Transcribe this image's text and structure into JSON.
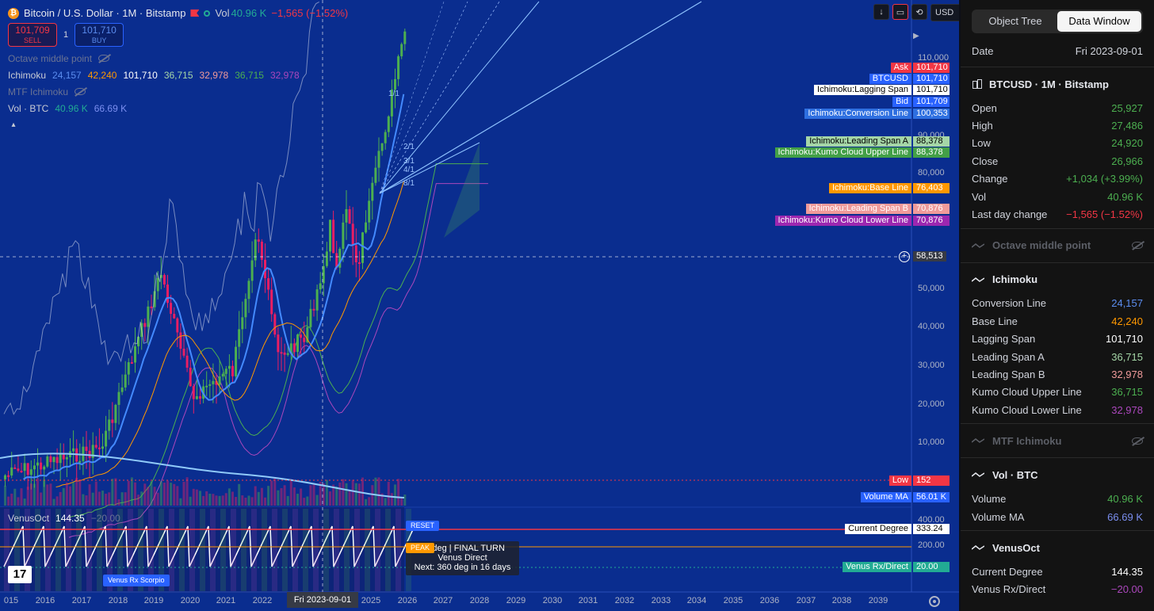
{
  "header": {
    "symbol_icon": "bitcoin-icon",
    "title": "Bitcoin / U.S. Dollar · 1M · Bitstamp",
    "vol_label": "Vol",
    "vol_value": "40.96 K",
    "change": "−1,565 (−1.52%)"
  },
  "trade": {
    "sell_price": "101,709",
    "sell_label": "SELL",
    "spread": "1",
    "buy_price": "101,710",
    "buy_label": "BUY"
  },
  "legend_indicators": {
    "octave": "Octave middle point",
    "ichimoku": "Ichimoku",
    "ichimoku_values": [
      "24,157",
      "42,240",
      "101,710",
      "36,715",
      "32,978",
      "36,715",
      "32,978"
    ],
    "mtf": "MTF Ichimoku",
    "vol": "Vol · BTC",
    "vol_values": [
      "40.96 K",
      "66.69 K"
    ]
  },
  "controls": {
    "currency": "USD"
  },
  "price_scale": {
    "ticks": [
      "110,000",
      "90,000",
      "80,000",
      "50,000",
      "40,000",
      "30,000",
      "20,000",
      "10,000",
      "400.00",
      "200.00"
    ],
    "crosshair_price": "58,513"
  },
  "price_labels": [
    {
      "name": "Ask",
      "value": "101,710",
      "color": "#f23645"
    },
    {
      "name": "BTCUSD",
      "value": "101,710",
      "color": "#2962ff"
    },
    {
      "name": "Ichimoku:Lagging Span",
      "value": "101,710",
      "color": "#ffffff"
    },
    {
      "name": "Bid",
      "value": "101,709",
      "color": "#2962ff"
    },
    {
      "name": "Ichimoku:Conversion Line",
      "value": "100,353",
      "color": "#2e6fe0"
    },
    {
      "name": "Ichimoku:Leading Span A",
      "value": "88,378",
      "color": "#a5d6a7"
    },
    {
      "name": "Ichimoku:Kumo Cloud Upper Line",
      "value": "88,378",
      "color": "#43a047"
    },
    {
      "name": "Ichimoku:Base Line",
      "value": "76,403",
      "color": "#ff9800"
    },
    {
      "name": "Ichimoku:Leading Span B",
      "value": "70,876",
      "color": "#ef9a9a"
    },
    {
      "name": "Ichimoku:Kumo Cloud Lower Line",
      "value": "70,876",
      "color": "#9c27b0"
    },
    {
      "name": "Low",
      "value": "152",
      "color": "#f23645"
    },
    {
      "name": "Volume MA",
      "value": "56.01 K",
      "color": "#2962ff"
    },
    {
      "name": "Current Degree",
      "value": "333.24",
      "color": "#ffffff"
    },
    {
      "name": "Venus Rx/Direct",
      "value": "20.00",
      "color": "#22ab94"
    }
  ],
  "fan_labels": [
    "2/1",
    "3/1",
    "4/1",
    "8/1",
    "1/1"
  ],
  "time_axis": {
    "ticks": [
      "015",
      "2016",
      "2017",
      "2018",
      "2019",
      "2020",
      "2021",
      "2022",
      "2025",
      "2026",
      "2027",
      "2028",
      "2029",
      "2030",
      "2031",
      "2032",
      "2033",
      "2034",
      "2035",
      "2036",
      "2037",
      "2038",
      "2039"
    ],
    "cursor": "Fri 2023-09-01"
  },
  "venus": {
    "name": "VenusOct",
    "value": "144.35",
    "value2": "−20.00",
    "tag": "Venus Rx Scorpio",
    "reset": "RESET",
    "peak": "PEAK",
    "tooltip_line1": "24 deg | FINAL TURN",
    "tooltip_line2": "Venus Direct",
    "tooltip_line3": "Next: 360 deg in 16 days"
  },
  "panel": {
    "tabs": [
      "Object Tree",
      "Data Window"
    ],
    "active_tab": "Data Window",
    "date_label": "Date",
    "date_value": "Fri 2023-09-01",
    "symbol_title": "BTCUSD · 1M · Bitstamp",
    "ohlc": [
      {
        "k": "Open",
        "v": "25,927",
        "color": "#4caf50"
      },
      {
        "k": "High",
        "v": "27,486",
        "color": "#4caf50"
      },
      {
        "k": "Low",
        "v": "24,920",
        "color": "#4caf50"
      },
      {
        "k": "Close",
        "v": "26,966",
        "color": "#4caf50"
      },
      {
        "k": "Change",
        "v": "+1,034 (+3.99%)",
        "color": "#4caf50"
      },
      {
        "k": "Vol",
        "v": "40.96 K",
        "color": "#4caf50"
      },
      {
        "k": "Last day change",
        "v": "−1,565 (−1.52%)",
        "color": "#f23645"
      }
    ],
    "octave_title": "Octave middle point",
    "ichimoku_title": "Ichimoku",
    "ichimoku": [
      {
        "k": "Conversion Line",
        "v": "24,157",
        "color": "#5b8def"
      },
      {
        "k": "Base Line",
        "v": "42,240",
        "color": "#ff9800"
      },
      {
        "k": "Lagging Span",
        "v": "101,710",
        "color": "#ffffff"
      },
      {
        "k": "Leading Span A",
        "v": "36,715",
        "color": "#a5d6a7"
      },
      {
        "k": "Leading Span B",
        "v": "32,978",
        "color": "#ef9a9a"
      },
      {
        "k": "Kumo Cloud Upper Line",
        "v": "36,715",
        "color": "#4caf50"
      },
      {
        "k": "Kumo Cloud Lower Line",
        "v": "32,978",
        "color": "#ab47bc"
      }
    ],
    "mtf_title": "MTF Ichimoku",
    "vol_title": "Vol · BTC",
    "vol": [
      {
        "k": "Volume",
        "v": "40.96 K",
        "color": "#4caf50"
      },
      {
        "k": "Volume MA",
        "v": "66.69 K",
        "color": "#7b8ff0"
      }
    ],
    "venus_title": "VenusOct",
    "venus": [
      {
        "k": "Current Degree",
        "v": "144.35",
        "color": "#ffffff"
      },
      {
        "k": "Venus Rx/Direct",
        "v": "−20.00",
        "color": "#ab47bc"
      }
    ]
  }
}
